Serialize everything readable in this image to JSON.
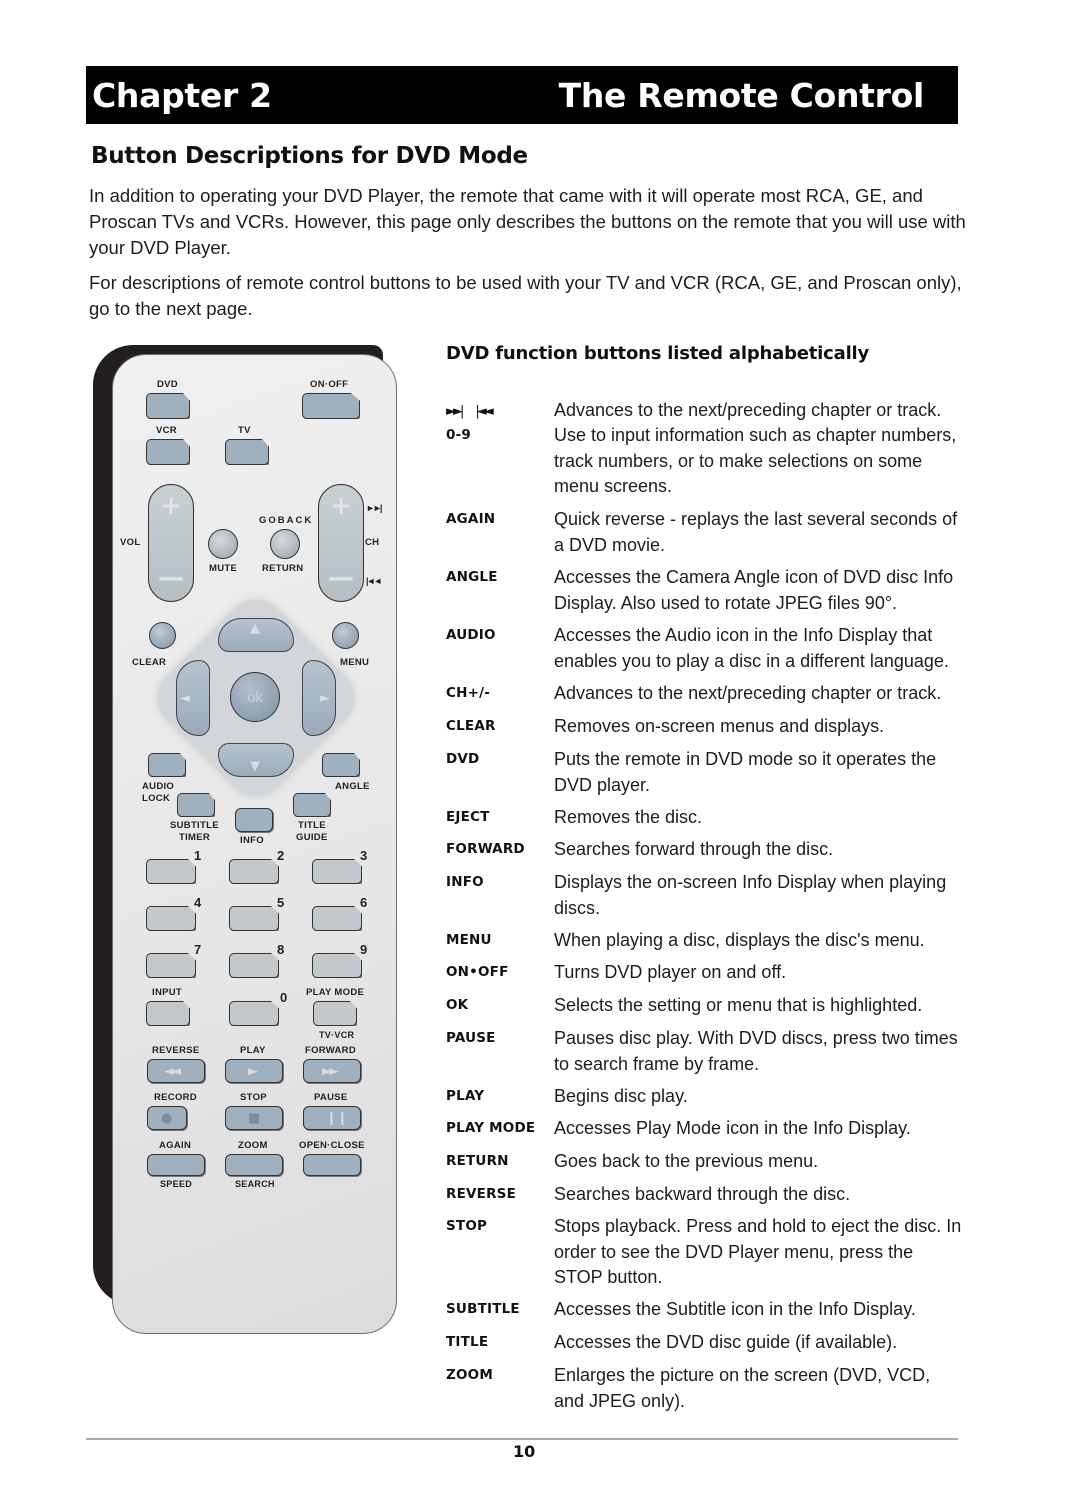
{
  "header": {
    "chapter": "Chapter 2",
    "title": "The Remote Control"
  },
  "section_title": "Button Descriptions for DVD Mode",
  "intro": [
    "In addition to operating your DVD Player, the remote that came with it will operate most RCA, GE, and Proscan TVs and VCRs. However, this page only describes the buttons on the remote that you will use with your DVD Player.",
    "For descriptions of remote control buttons to be used with your TV and VCR (RCA, GE, and Proscan only), go to the next page."
  ],
  "remote": {
    "labels": {
      "dvd": "DVD",
      "on_off": "ON·OFF",
      "vcr": "VCR",
      "tv": "TV",
      "vol": "VOL",
      "ch": "CH",
      "goback": "GOBACK",
      "mute": "MUTE",
      "return": "RETURN",
      "clear": "CLEAR",
      "menu": "MENU",
      "ok": "ok",
      "audio": "AUDIO",
      "lock": "LOCK",
      "angle": "ANGLE",
      "subtitle": "SUBTITLE",
      "timer": "TIMER",
      "info": "INFO",
      "title": "TITLE",
      "guide": "GUIDE",
      "input": "INPUT",
      "play_mode": "PLAY MODE",
      "tv_vcr": "TV·VCR",
      "reverse": "REVERSE",
      "play": "PLAY",
      "forward": "FORWARD",
      "record": "RECORD",
      "stop": "STOP",
      "pause": "PAUSE",
      "again": "AGAIN",
      "zoom": "ZOOM",
      "open_close": "OPEN·CLOSE",
      "speed": "SPEED",
      "search": "SEARCH"
    },
    "digits": [
      "1",
      "2",
      "3",
      "4",
      "5",
      "6",
      "7",
      "8",
      "9",
      "0"
    ],
    "plus": "+",
    "minus": "—"
  },
  "function_list": {
    "title": "DVD function buttons listed alphabetically",
    "skip_icons": [
      "►►|",
      "|◄◄"
    ],
    "entries": [
      {
        "key": "",
        "desc": "Advances to the next/preceding chapter or track."
      },
      {
        "key": "0-9",
        "desc": "Use to input information such as chapter numbers, track numbers, or to make selections on some menu screens."
      },
      {
        "key": "AGAIN",
        "desc": "Quick reverse - replays the last several seconds of a DVD movie."
      },
      {
        "key": "ANGLE",
        "desc": "Accesses the Camera Angle icon of DVD disc Info Display. Also used to rotate JPEG files 90°."
      },
      {
        "key": "AUDIO",
        "desc": "Accesses the Audio icon in the Info Display that enables you to play a disc in a different language."
      },
      {
        "key": "CH+/-",
        "desc": "Advances to the next/preceding chapter or track."
      },
      {
        "key": "CLEAR",
        "desc": "Removes on-screen menus and displays."
      },
      {
        "key": "DVD",
        "desc": "Puts the remote in DVD mode so it operates the DVD player."
      },
      {
        "key": "EJECT",
        "desc": "Removes the disc."
      },
      {
        "key": "FORWARD",
        "desc": "Searches forward through the disc."
      },
      {
        "key": "INFO",
        "desc": "Displays the on-screen Info Display when playing discs."
      },
      {
        "key": "MENU",
        "desc": "When playing a disc, displays the disc's menu."
      },
      {
        "key": "ON•OFF",
        "desc": "Turns DVD player on and off."
      },
      {
        "key": "OK",
        "desc": "Selects the setting or menu that is highlighted."
      },
      {
        "key": "PAUSE",
        "desc": "Pauses disc play. With DVD discs, press two times to search frame by frame."
      },
      {
        "key": "PLAY",
        "desc": "Begins disc play."
      },
      {
        "key": "PLAY MODE",
        "desc": "Accesses Play Mode icon in the Info Display."
      },
      {
        "key": "RETURN",
        "desc": "Goes back to the previous menu."
      },
      {
        "key": "REVERSE",
        "desc": "Searches backward through the disc."
      },
      {
        "key": "STOP",
        "desc": "Stops playback. Press and hold to eject the disc. In order to see the DVD Player menu, press the STOP button."
      },
      {
        "key": "SUBTITLE",
        "desc": "Accesses the Subtitle icon in the Info Display."
      },
      {
        "key": "TITLE",
        "desc": "Accesses the DVD disc guide (if available)."
      },
      {
        "key": "ZOOM",
        "desc": "Enlarges the picture on the screen (DVD, VCD, and JPEG only)."
      }
    ]
  },
  "page_number": "10"
}
